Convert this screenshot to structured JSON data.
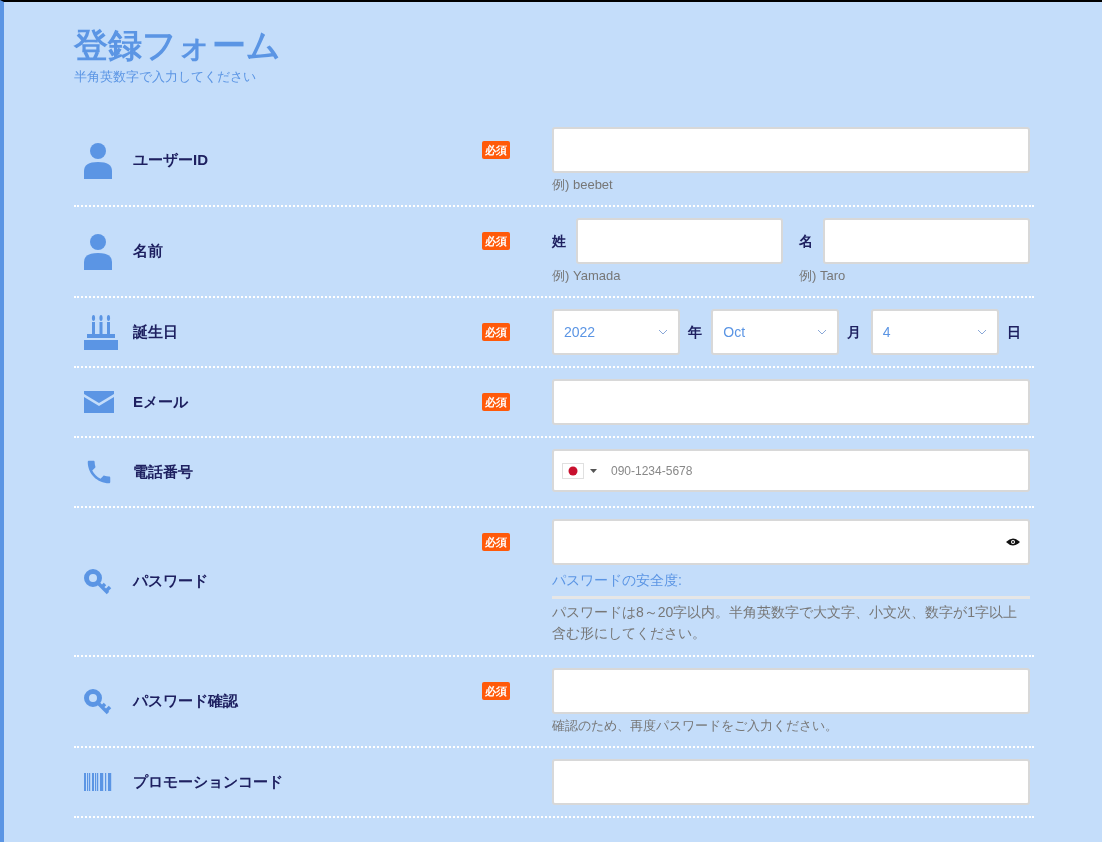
{
  "header": {
    "title": "登録フォーム",
    "subtitle": "半角英数字で入力してください"
  },
  "rows": [
    {
      "kind": "userid",
      "label": "ユーザーID",
      "badge": "必須",
      "hint": "例) beebet"
    },
    {
      "kind": "name",
      "label": "名前",
      "badge": "必須",
      "parts": [
        {
          "label": "姓",
          "hint": "例) Yamada"
        },
        {
          "label": "名",
          "hint": "例) Taro"
        }
      ]
    },
    {
      "kind": "date",
      "label": "誕生日",
      "badge": "必須",
      "selects": [
        {
          "value": "2022",
          "unit": "年"
        },
        {
          "value": "Oct",
          "unit": "月"
        },
        {
          "value": "4",
          "unit": "日"
        }
      ]
    },
    {
      "kind": "email",
      "label": "Eメール",
      "badge": "必須"
    },
    {
      "kind": "phone",
      "label": "電話番号",
      "placeholder": "090-1234-5678"
    },
    {
      "kind": "password",
      "label": "パスワード",
      "badge": "必須",
      "strength": {
        "label": "パスワードの安全度:",
        "level": 0
      },
      "hint": "パスワードは8～20字以内。半角英数字で大文字、小文次、数字が1字以上含む形にしてください。"
    },
    {
      "kind": "confirm",
      "label": "パスワード確認",
      "badge": "必須",
      "hint": "確認のため、再度パスワードをご入力ください。"
    },
    {
      "kind": "code",
      "label": "プロモーションコード"
    }
  ]
}
